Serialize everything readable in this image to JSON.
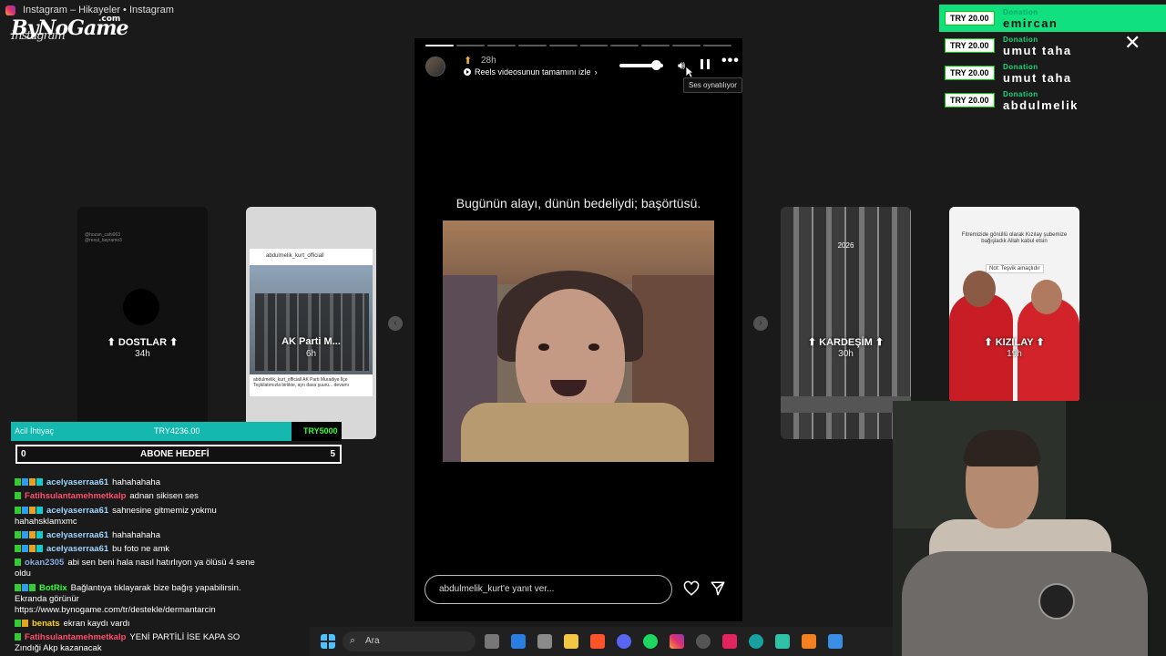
{
  "window": {
    "title": "Instagram – Hikayeler • Instagram"
  },
  "logo": {
    "brand": "ByNoGame",
    "suffix": ".com",
    "sub": "Instagram"
  },
  "story": {
    "time": "28h",
    "reels_link": "Reels videosunun tamamını izle",
    "tooltip": "Ses oynatılıyor",
    "caption": "Bugünün alayı, dünün bedeliydi; başörtüsü.",
    "reply_placeholder": "abdulmelik_kurt'e yanıt ver...",
    "more_label": "•••"
  },
  "cards": [
    {
      "label": "DOSTLAR",
      "time": "34h",
      "tiny": "@hozan_cahi063\n@resul_bayramo3"
    },
    {
      "label": "AK Parti M...",
      "time": "6h",
      "post_user": "abdulmelik_kurt_officiall",
      "post_caption": "abdulmelik_kurt_officiall AK Parti Muradiye İlçe Teşkilatımızla birlikte, ayrı dava şuuru... devamı"
    },
    {
      "label": "KARDEŞİM",
      "time": "30h",
      "year": "2026"
    },
    {
      "label": "KIZILAY",
      "time": "19h",
      "note": "Fitremizide gönüllü olarak Kızılay şubemize bağışladık Allah kabul etsin",
      "note2": "Not: Teşvik amaçlıdır"
    }
  ],
  "donations": [
    {
      "amount": "TRY 20.00",
      "label": "Donation",
      "name": "emircan"
    },
    {
      "amount": "TRY 20.00",
      "label": "Donation",
      "name": "umut taha"
    },
    {
      "amount": "TRY 20.00",
      "label": "Donation",
      "name": "umut taha"
    },
    {
      "amount": "TRY 20.00",
      "label": "Donation",
      "name": "abdulmelik"
    }
  ],
  "goal_need": {
    "label": "Acil İhtiyaç",
    "current": "TRY4236.00",
    "target": "TRY5000"
  },
  "goal_sub": {
    "left": "0",
    "label": "ABONE HEDEFİ",
    "right": "5"
  },
  "chat": [
    {
      "user": "acelyaserraa61",
      "color": "u-blue",
      "text": "hahahahaha",
      "badges": [
        "b-green",
        "b-blue",
        "b-gold",
        "b-teal"
      ]
    },
    {
      "user": "Fatihsulantamehmetkalp",
      "color": "u-red",
      "text": "adnan sikisen ses",
      "badges": [
        "b-green"
      ]
    },
    {
      "user": "acelyaserraa61",
      "color": "u-blue",
      "text": "sahnesine gitmemiz yokmu hahahsklamxmc",
      "badges": [
        "b-green",
        "b-blue",
        "b-gold",
        "b-teal"
      ]
    },
    {
      "user": "acelyaserraa61",
      "color": "u-blue",
      "text": "hahahahaha",
      "badges": [
        "b-green",
        "b-blue",
        "b-gold",
        "b-teal"
      ]
    },
    {
      "user": "acelyaserraa61",
      "color": "u-blue",
      "text": "bu foto ne amk",
      "badges": [
        "b-green",
        "b-blue",
        "b-gold",
        "b-teal"
      ]
    },
    {
      "user": "okan2305",
      "color": "u-sky",
      "text": "abi sen beni hala nasıl hatırlıyon ya ölüsü 4 sene oldu",
      "badges": [
        "b-green"
      ]
    },
    {
      "user": "BotRix",
      "color": "u-grn",
      "text": "Bağlantıya tıklayarak bize bağış yapabilirsin. Ekranda görünür https://www.bynogame.com/tr/destekle/dermantarcin",
      "badges": [
        "b-green",
        "b-blue",
        "b-green"
      ]
    },
    {
      "user": "benats",
      "color": "u-yel",
      "text": "ekran kaydı vardı",
      "badges": [
        "b-green",
        "b-gold"
      ]
    },
    {
      "user": "Fatihsulantamehmetkalp",
      "color": "u-red",
      "text": "YENİ PARTİLİ İSE KAPA SO Zındıği Akp kazanacak",
      "badges": [
        "b-green"
      ]
    }
  ],
  "taskbar": {
    "search": "Ara"
  },
  "colors": {
    "donation_green": "#10e07e",
    "goal_teal": "#15b8ae",
    "story_bg": "#000000"
  }
}
